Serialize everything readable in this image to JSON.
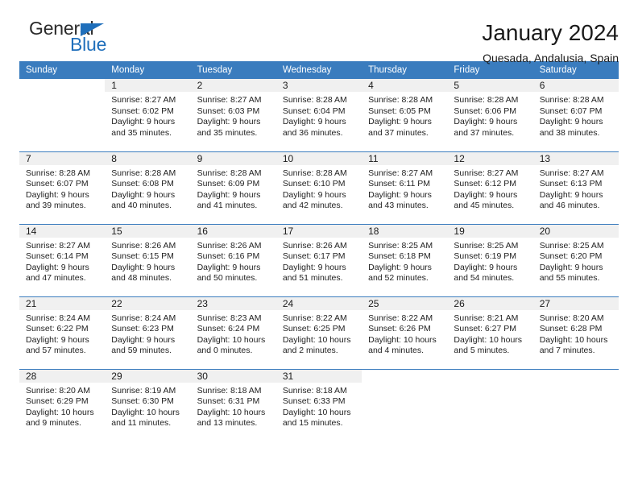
{
  "brand": {
    "word1": "General",
    "word2": "Blue",
    "flag_icon": "triangle-flag-icon",
    "accent_color": "#1f6fbb"
  },
  "header": {
    "title": "January 2024",
    "subtitle": "Quesada, Andalusia, Spain"
  },
  "calendar": {
    "header_bg": "#3a7cbe",
    "daynum_bg": "#f0f0f0",
    "weekday_headers": [
      "Sunday",
      "Monday",
      "Tuesday",
      "Wednesday",
      "Thursday",
      "Friday",
      "Saturday"
    ],
    "weeks": [
      [
        {
          "day": "",
          "lines": []
        },
        {
          "day": "1",
          "lines": [
            "Sunrise: 8:27 AM",
            "Sunset: 6:02 PM",
            "Daylight: 9 hours",
            "and 35 minutes."
          ]
        },
        {
          "day": "2",
          "lines": [
            "Sunrise: 8:27 AM",
            "Sunset: 6:03 PM",
            "Daylight: 9 hours",
            "and 35 minutes."
          ]
        },
        {
          "day": "3",
          "lines": [
            "Sunrise: 8:28 AM",
            "Sunset: 6:04 PM",
            "Daylight: 9 hours",
            "and 36 minutes."
          ]
        },
        {
          "day": "4",
          "lines": [
            "Sunrise: 8:28 AM",
            "Sunset: 6:05 PM",
            "Daylight: 9 hours",
            "and 37 minutes."
          ]
        },
        {
          "day": "5",
          "lines": [
            "Sunrise: 8:28 AM",
            "Sunset: 6:06 PM",
            "Daylight: 9 hours",
            "and 37 minutes."
          ]
        },
        {
          "day": "6",
          "lines": [
            "Sunrise: 8:28 AM",
            "Sunset: 6:07 PM",
            "Daylight: 9 hours",
            "and 38 minutes."
          ]
        }
      ],
      [
        {
          "day": "7",
          "lines": [
            "Sunrise: 8:28 AM",
            "Sunset: 6:07 PM",
            "Daylight: 9 hours",
            "and 39 minutes."
          ]
        },
        {
          "day": "8",
          "lines": [
            "Sunrise: 8:28 AM",
            "Sunset: 6:08 PM",
            "Daylight: 9 hours",
            "and 40 minutes."
          ]
        },
        {
          "day": "9",
          "lines": [
            "Sunrise: 8:28 AM",
            "Sunset: 6:09 PM",
            "Daylight: 9 hours",
            "and 41 minutes."
          ]
        },
        {
          "day": "10",
          "lines": [
            "Sunrise: 8:28 AM",
            "Sunset: 6:10 PM",
            "Daylight: 9 hours",
            "and 42 minutes."
          ]
        },
        {
          "day": "11",
          "lines": [
            "Sunrise: 8:27 AM",
            "Sunset: 6:11 PM",
            "Daylight: 9 hours",
            "and 43 minutes."
          ]
        },
        {
          "day": "12",
          "lines": [
            "Sunrise: 8:27 AM",
            "Sunset: 6:12 PM",
            "Daylight: 9 hours",
            "and 45 minutes."
          ]
        },
        {
          "day": "13",
          "lines": [
            "Sunrise: 8:27 AM",
            "Sunset: 6:13 PM",
            "Daylight: 9 hours",
            "and 46 minutes."
          ]
        }
      ],
      [
        {
          "day": "14",
          "lines": [
            "Sunrise: 8:27 AM",
            "Sunset: 6:14 PM",
            "Daylight: 9 hours",
            "and 47 minutes."
          ]
        },
        {
          "day": "15",
          "lines": [
            "Sunrise: 8:26 AM",
            "Sunset: 6:15 PM",
            "Daylight: 9 hours",
            "and 48 minutes."
          ]
        },
        {
          "day": "16",
          "lines": [
            "Sunrise: 8:26 AM",
            "Sunset: 6:16 PM",
            "Daylight: 9 hours",
            "and 50 minutes."
          ]
        },
        {
          "day": "17",
          "lines": [
            "Sunrise: 8:26 AM",
            "Sunset: 6:17 PM",
            "Daylight: 9 hours",
            "and 51 minutes."
          ]
        },
        {
          "day": "18",
          "lines": [
            "Sunrise: 8:25 AM",
            "Sunset: 6:18 PM",
            "Daylight: 9 hours",
            "and 52 minutes."
          ]
        },
        {
          "day": "19",
          "lines": [
            "Sunrise: 8:25 AM",
            "Sunset: 6:19 PM",
            "Daylight: 9 hours",
            "and 54 minutes."
          ]
        },
        {
          "day": "20",
          "lines": [
            "Sunrise: 8:25 AM",
            "Sunset: 6:20 PM",
            "Daylight: 9 hours",
            "and 55 minutes."
          ]
        }
      ],
      [
        {
          "day": "21",
          "lines": [
            "Sunrise: 8:24 AM",
            "Sunset: 6:22 PM",
            "Daylight: 9 hours",
            "and 57 minutes."
          ]
        },
        {
          "day": "22",
          "lines": [
            "Sunrise: 8:24 AM",
            "Sunset: 6:23 PM",
            "Daylight: 9 hours",
            "and 59 minutes."
          ]
        },
        {
          "day": "23",
          "lines": [
            "Sunrise: 8:23 AM",
            "Sunset: 6:24 PM",
            "Daylight: 10 hours",
            "and 0 minutes."
          ]
        },
        {
          "day": "24",
          "lines": [
            "Sunrise: 8:22 AM",
            "Sunset: 6:25 PM",
            "Daylight: 10 hours",
            "and 2 minutes."
          ]
        },
        {
          "day": "25",
          "lines": [
            "Sunrise: 8:22 AM",
            "Sunset: 6:26 PM",
            "Daylight: 10 hours",
            "and 4 minutes."
          ]
        },
        {
          "day": "26",
          "lines": [
            "Sunrise: 8:21 AM",
            "Sunset: 6:27 PM",
            "Daylight: 10 hours",
            "and 5 minutes."
          ]
        },
        {
          "day": "27",
          "lines": [
            "Sunrise: 8:20 AM",
            "Sunset: 6:28 PM",
            "Daylight: 10 hours",
            "and 7 minutes."
          ]
        }
      ],
      [
        {
          "day": "28",
          "lines": [
            "Sunrise: 8:20 AM",
            "Sunset: 6:29 PM",
            "Daylight: 10 hours",
            "and 9 minutes."
          ]
        },
        {
          "day": "29",
          "lines": [
            "Sunrise: 8:19 AM",
            "Sunset: 6:30 PM",
            "Daylight: 10 hours",
            "and 11 minutes."
          ]
        },
        {
          "day": "30",
          "lines": [
            "Sunrise: 8:18 AM",
            "Sunset: 6:31 PM",
            "Daylight: 10 hours",
            "and 13 minutes."
          ]
        },
        {
          "day": "31",
          "lines": [
            "Sunrise: 8:18 AM",
            "Sunset: 6:33 PM",
            "Daylight: 10 hours",
            "and 15 minutes."
          ]
        },
        {
          "day": "",
          "lines": []
        },
        {
          "day": "",
          "lines": []
        },
        {
          "day": "",
          "lines": []
        }
      ]
    ]
  }
}
